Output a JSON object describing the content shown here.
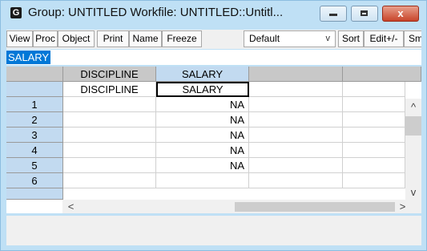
{
  "window": {
    "title": "Group: UNTITLED   Workfile: UNTITLED::Untitl...",
    "icon_letter": "G"
  },
  "toolbar": {
    "buttons": [
      "View",
      "Proc",
      "Object",
      "Print",
      "Name",
      "Freeze",
      "Sort",
      "Edit+/-",
      "Sm"
    ],
    "select_value": "Default"
  },
  "namebar": {
    "selected_text": "SALARY"
  },
  "grid": {
    "columns": [
      "DISCIPLINE",
      "SALARY",
      "",
      ""
    ],
    "name_row": [
      "DISCIPLINE",
      "SALARY",
      "",
      ""
    ],
    "rows": [
      {
        "obs": "1",
        "discipline": "",
        "salary": "NA"
      },
      {
        "obs": "2",
        "discipline": "",
        "salary": "NA"
      },
      {
        "obs": "3",
        "discipline": "",
        "salary": "NA"
      },
      {
        "obs": "4",
        "discipline": "",
        "salary": "NA"
      },
      {
        "obs": "5",
        "discipline": "",
        "salary": "NA"
      },
      {
        "obs": "6",
        "discipline": "",
        "salary": ""
      }
    ]
  },
  "icons": {
    "scroll_up": "^",
    "scroll_down": "v",
    "scroll_left": "<",
    "scroll_right": ">",
    "chevron": "v",
    "close": "x"
  }
}
